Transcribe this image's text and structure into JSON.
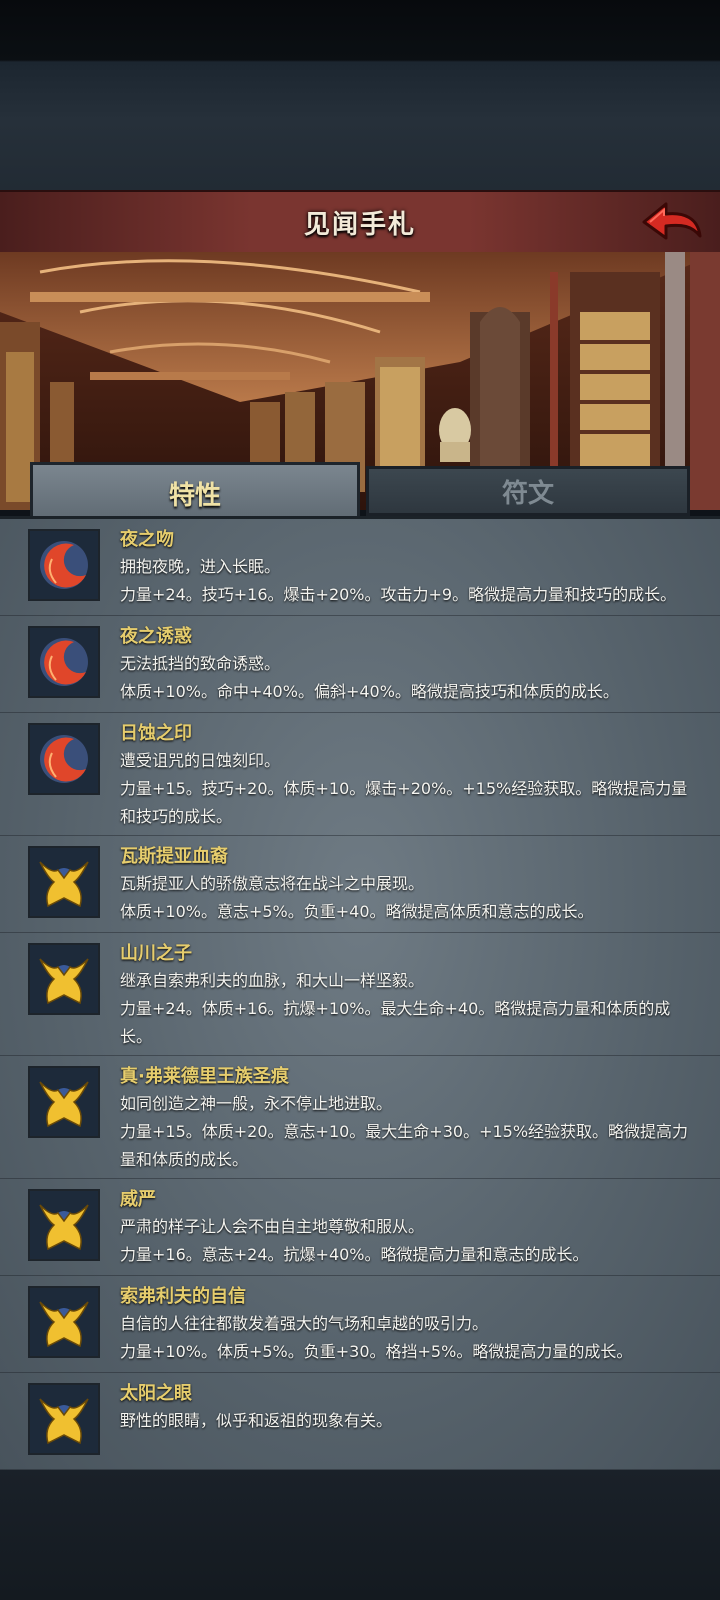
{
  "header": {
    "title": "见闻手札"
  },
  "tabs": [
    {
      "label": "特性",
      "active": true
    },
    {
      "label": "符文",
      "active": false
    }
  ],
  "traits": [
    {
      "name": "夜之吻",
      "icon": "crescent-moon-icon",
      "desc": "拥抱夜晚，进入长眠。",
      "stats": "力量+24。技巧+16。爆击+20%。攻击力+9。略微提高力量和技巧的成长。"
    },
    {
      "name": "夜之诱惑",
      "icon": "crescent-moon-icon",
      "desc": "无法抵挡的致命诱惑。",
      "stats": "体质+10%。命中+40%。偏斜+40%。略微提高技巧和体质的成长。"
    },
    {
      "name": "日蚀之印",
      "icon": "crescent-moon-icon",
      "desc": "遭受诅咒的日蚀刻印。",
      "stats": "力量+15。技巧+20。体质+10。爆击+20%。+15%经验获取。略微提高力量和技巧的成长。"
    },
    {
      "name": "瓦斯提亚血裔",
      "icon": "golden-crown-icon",
      "desc": "瓦斯提亚人的骄傲意志将在战斗之中展现。",
      "stats": "体质+10%。意志+5%。负重+40。略微提高体质和意志的成长。"
    },
    {
      "name": "山川之子",
      "icon": "golden-crown-icon",
      "desc": "继承自索弗利夫的血脉，和大山一样坚毅。",
      "stats": "力量+24。体质+16。抗爆+10%。最大生命+40。略微提高力量和体质的成长。"
    },
    {
      "name": "真·弗莱德里王族圣痕",
      "icon": "golden-crown-icon",
      "desc": "如同创造之神一般，永不停止地进取。",
      "stats": "力量+15。体质+20。意志+10。最大生命+30。+15%经验获取。略微提高力量和体质的成长。"
    },
    {
      "name": "威严",
      "icon": "golden-crown-icon",
      "desc": "严肃的样子让人会不由自主地尊敬和服从。",
      "stats": "力量+16。意志+24。抗爆+40%。略微提高力量和意志的成长。"
    },
    {
      "name": "索弗利夫的自信",
      "icon": "golden-crown-icon",
      "desc": "自信的人往往都散发着强大的气场和卓越的吸引力。",
      "stats": "力量+10%。体质+5%。负重+30。格挡+5%。略微提高力量的成长。"
    },
    {
      "name": "太阳之眼",
      "icon": "golden-crown-icon",
      "desc": "野性的眼睛，似乎和返祖的现象有关。",
      "stats": ""
    }
  ]
}
